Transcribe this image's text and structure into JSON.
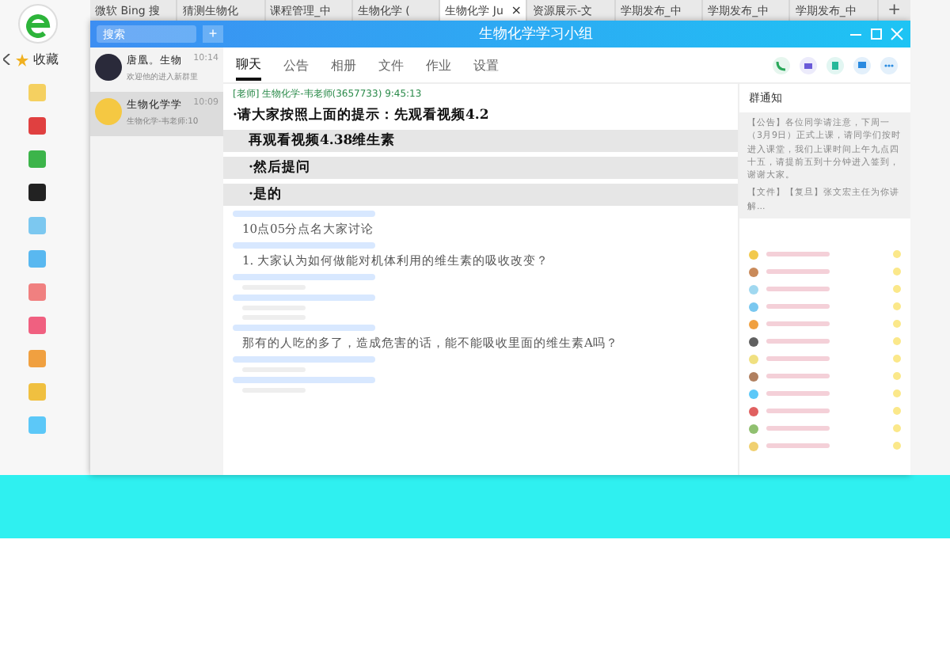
{
  "browser": {
    "tabs": [
      {
        "label": "微软 Bing 搜",
        "selected": false
      },
      {
        "label": "猜测生物化",
        "selected": false
      },
      {
        "label": "课程管理_中",
        "selected": false
      },
      {
        "label": "生物化学 (",
        "selected": false
      },
      {
        "label": "生物化学 Ju",
        "selected": true
      },
      {
        "label": "资源展示-文",
        "selected": false
      },
      {
        "label": "学期发布_中",
        "selected": false
      },
      {
        "label": "学期发布_中",
        "selected": false
      },
      {
        "label": "学期发布_中",
        "selected": false
      }
    ],
    "new_tab": "+",
    "close_tab": "×",
    "favorites": "收藏"
  },
  "qq": {
    "search": {
      "placeholder": "搜索"
    },
    "add": "+",
    "title": "生物化学学习小组",
    "conversations": [
      {
        "name": "唐凰。生物",
        "time": "10:14",
        "preview": "欢迎他的进入新群里",
        "selected": false
      },
      {
        "name": "生物化学学",
        "time": "10:09",
        "preview": "生物化学-韦老师:10",
        "selected": true
      }
    ],
    "tabs": [
      {
        "label": "聊天",
        "selected": true
      },
      {
        "label": "公告",
        "selected": false
      },
      {
        "label": "相册",
        "selected": false
      },
      {
        "label": "文件",
        "selected": false
      },
      {
        "label": "作业",
        "selected": false
      },
      {
        "label": "设置",
        "selected": false
      }
    ],
    "messages": [
      {
        "kind": "sender",
        "text": "[老师] 生物化学-韦老师(3657733)  9:45:13"
      },
      {
        "kind": "bold",
        "text": "·请大家按照上面的提示：先观看视频4.2"
      },
      {
        "kind": "bold-gray",
        "text": "再观看视频4.38维生素"
      },
      {
        "kind": "bold-gray",
        "text": "·然后提问"
      },
      {
        "kind": "bold-gray",
        "text": "·是的"
      },
      {
        "kind": "faint"
      },
      {
        "kind": "text",
        "text": "10点05分点名大家讨论"
      },
      {
        "kind": "faint"
      },
      {
        "kind": "text",
        "text": "1. 大家认为如何做能对机体利用的维生素的吸收改变？"
      },
      {
        "kind": "faint"
      },
      {
        "kind": "faint-line"
      },
      {
        "kind": "faint"
      },
      {
        "kind": "faint-line"
      },
      {
        "kind": "faint-line"
      },
      {
        "kind": "faint"
      },
      {
        "kind": "text",
        "text": "那有的人吃的多了，造成危害的话，能不能吸收里面的维生素A吗？"
      },
      {
        "kind": "faint"
      },
      {
        "kind": "faint-line"
      },
      {
        "kind": "faint"
      },
      {
        "kind": "faint-line"
      }
    ],
    "notice": {
      "title": "群通知",
      "items": [
        {
          "tag": "【公告】",
          "text": "各位同学请注意，下周一（3月9日）正式上课，请同学们按时进入课堂，我们上课时间上午九点四十五，请提前五到十分钟进入签到，谢谢大家。"
        },
        {
          "tag": "【文件】",
          "text": "【复旦】张文宏主任为你讲解..."
        }
      ]
    },
    "members": [
      {
        "color": "#f2c94c"
      },
      {
        "color": "#c98a5a"
      },
      {
        "color": "#a0d8f0"
      },
      {
        "color": "#7ac8f0"
      },
      {
        "color": "#f0a040"
      },
      {
        "color": "#606060"
      },
      {
        "color": "#f0e080"
      },
      {
        "color": "#b08060"
      },
      {
        "color": "#5cc8f8"
      },
      {
        "color": "#e06060"
      },
      {
        "color": "#90c070"
      },
      {
        "color": "#f0d070"
      }
    ]
  }
}
